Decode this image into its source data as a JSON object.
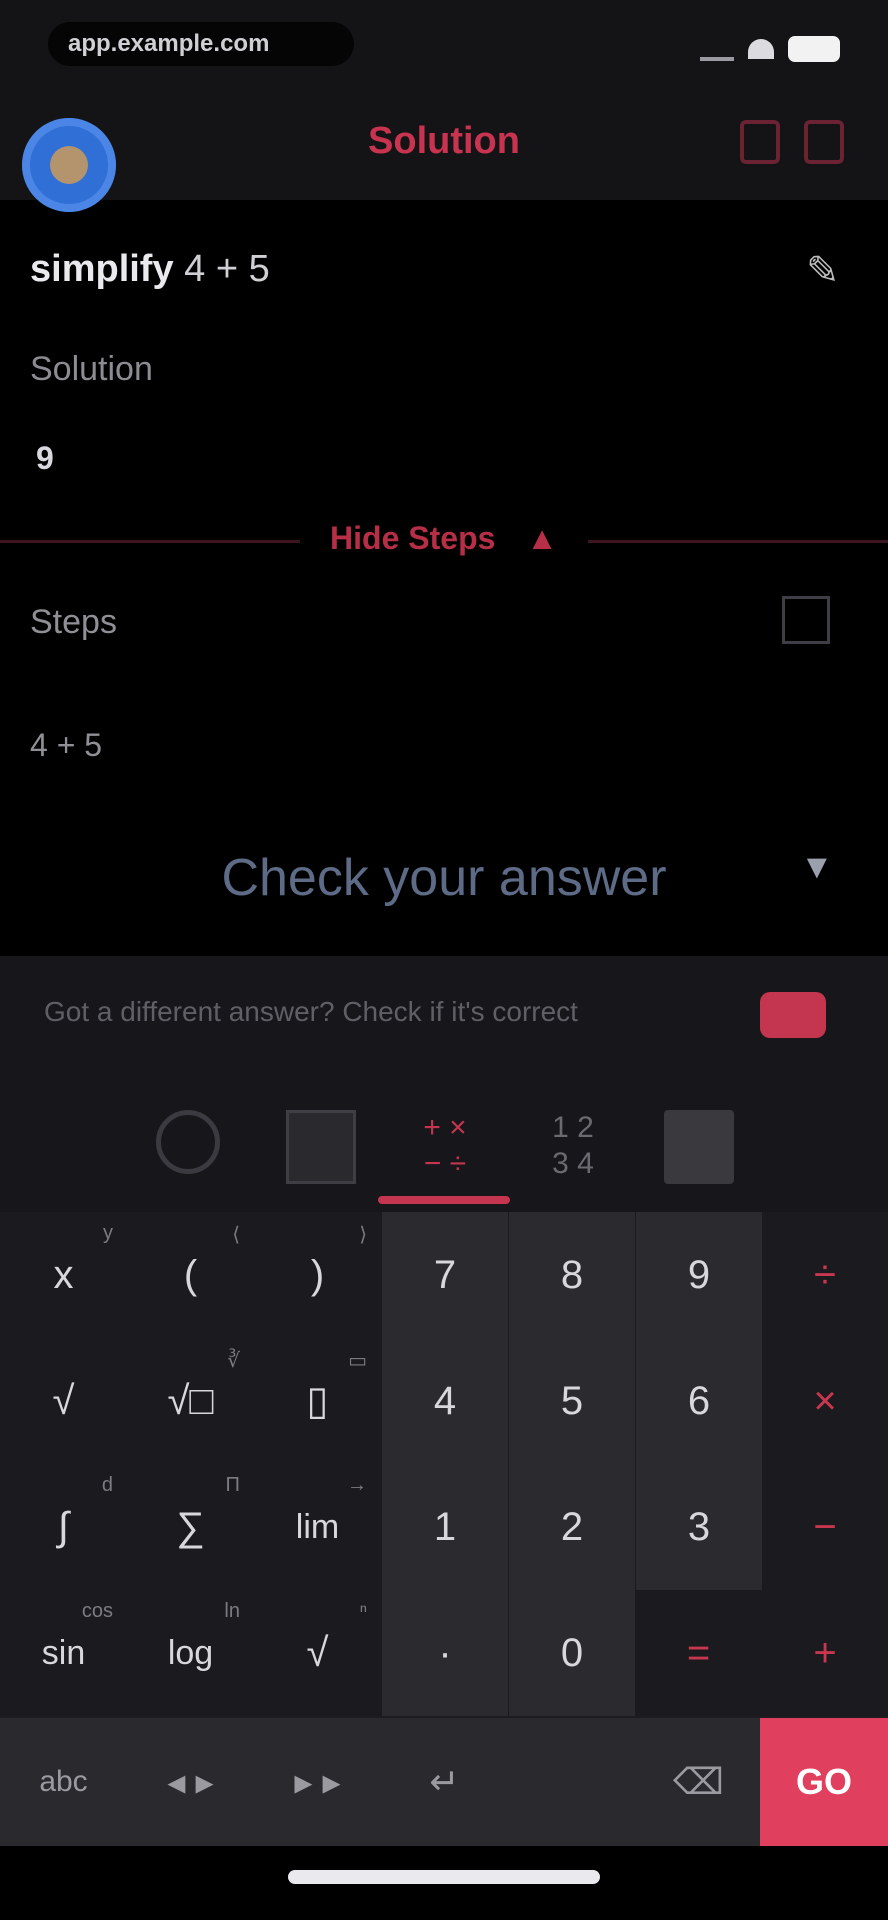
{
  "status_bar": {
    "pill_text": "app.example.com"
  },
  "header": {
    "title": "Solution"
  },
  "problem": {
    "prefix": "simplify",
    "expression": "4 + 5",
    "solution_label": "Solution",
    "answer": "9",
    "hide_steps_label": "Hide Steps",
    "steps_label": "Steps",
    "step_expression": "4 + 5",
    "check_answer_label": "Check your answer",
    "tip_text": "Got a different answer? Check if it's correct"
  },
  "keyboard": {
    "left_keys": [
      {
        "label": "x",
        "sup": "y"
      },
      {
        "label": "(",
        "sup": "⟨"
      },
      {
        "label": ")",
        "sup": "⟩"
      },
      {
        "label": "√",
        "sup": ""
      },
      {
        "label": "√□",
        "sup": "∛"
      },
      {
        "label": "▯",
        "sup": "▭"
      },
      {
        "label": "∫",
        "sup": "d"
      },
      {
        "label": "∑",
        "sup": "Π"
      },
      {
        "label": "lim",
        "sup": "→"
      },
      {
        "label": "sin",
        "sup": "cos"
      },
      {
        "label": "log",
        "sup": "ln"
      },
      {
        "label": "√",
        "sup": "ⁿ"
      }
    ],
    "num_keys": [
      "7",
      "8",
      "9",
      "4",
      "5",
      "6",
      "1",
      "2",
      "3",
      "·",
      "0"
    ],
    "op_keys": [
      "÷",
      "×",
      "−",
      "=",
      "+"
    ],
    "bottom_keys": [
      "abc",
      "◂ ▸",
      "▸ ▸",
      "↵",
      "⌫"
    ],
    "go_label": "GO"
  }
}
